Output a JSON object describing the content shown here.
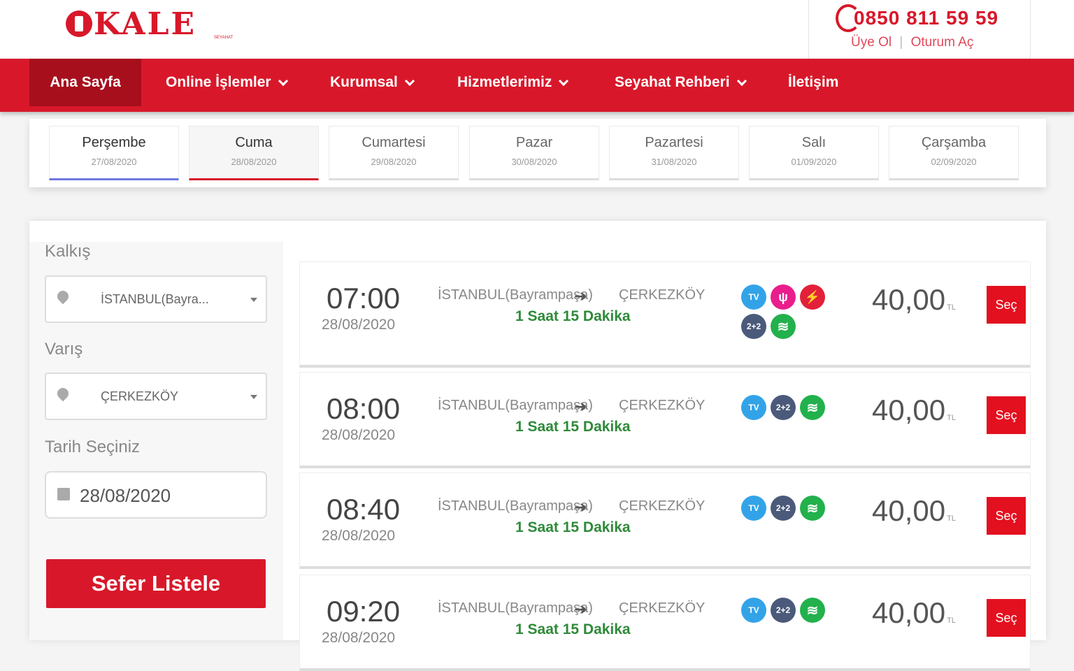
{
  "header": {
    "logo_text": "KALE",
    "logo_sub": "SEYAHAT",
    "phone": "0850 811 59 59",
    "signup": "Üye Ol",
    "separator": "|",
    "login": "Oturum Aç"
  },
  "nav": {
    "home": "Ana Sayfa",
    "online": "Online İşlemler",
    "corporate": "Kurumsal",
    "services": "Hizmetlerimiz",
    "guide": "Seyahat Rehberi",
    "contact": "İletişim"
  },
  "days": [
    {
      "name": "Perşembe",
      "date": "27/08/2020"
    },
    {
      "name": "Cuma",
      "date": "28/08/2020"
    },
    {
      "name": "Cumartesi",
      "date": "29/08/2020"
    },
    {
      "name": "Pazar",
      "date": "30/08/2020"
    },
    {
      "name": "Pazartesi",
      "date": "31/08/2020"
    },
    {
      "name": "Salı",
      "date": "01/09/2020"
    },
    {
      "name": "Çarşamba",
      "date": "02/09/2020"
    }
  ],
  "search": {
    "from_label": "Kalkış",
    "from_value": "İSTANBUL(Bayra...",
    "to_label": "Varış",
    "to_value": "ÇERKEZKÖY",
    "date_label": "Tarih Seçiniz",
    "date_value": "28/08/2020",
    "submit": "Sefer Listele"
  },
  "trips": [
    {
      "time": "07:00",
      "date": "28/08/2020",
      "from": "İSTANBUL(Bayrampaşa)",
      "to": "ÇERKEZKÖY",
      "duration": "1 Saat 15 Dakika",
      "price": "40,00",
      "currency": "TL",
      "select": "Seç",
      "features": [
        "tv-icon",
        "food-icon",
        "power-icon",
        "seat-2+2-icon",
        "wifi-icon"
      ]
    },
    {
      "time": "08:00",
      "date": "28/08/2020",
      "from": "İSTANBUL(Bayrampaşa)",
      "to": "ÇERKEZKÖY",
      "duration": "1 Saat 15 Dakika",
      "price": "40,00",
      "currency": "TL",
      "select": "Seç",
      "features": [
        "tv-icon",
        "seat-2+2-icon",
        "wifi-icon"
      ]
    },
    {
      "time": "08:40",
      "date": "28/08/2020",
      "from": "İSTANBUL(Bayrampaşa)",
      "to": "ÇERKEZKÖY",
      "duration": "1 Saat 15 Dakika",
      "price": "40,00",
      "currency": "TL",
      "select": "Seç",
      "features": [
        "tv-icon",
        "seat-2+2-icon",
        "wifi-icon"
      ]
    },
    {
      "time": "09:20",
      "date": "28/08/2020",
      "from": "İSTANBUL(Bayrampaşa)",
      "to": "ÇERKEZKÖY",
      "duration": "1 Saat 15 Dakika",
      "price": "40,00",
      "currency": "TL",
      "select": "Seç",
      "features": [
        "tv-icon",
        "seat-2+2-icon",
        "wifi-icon"
      ]
    }
  ],
  "feature_labels": {
    "tv": "TV",
    "seat": "2+2",
    "wifi": "≋",
    "food": "ψ",
    "power": "⚡"
  },
  "colors": {
    "brand": "#d8182a",
    "brand_dark": "#a70f1d",
    "duration": "#2f8a3a"
  }
}
